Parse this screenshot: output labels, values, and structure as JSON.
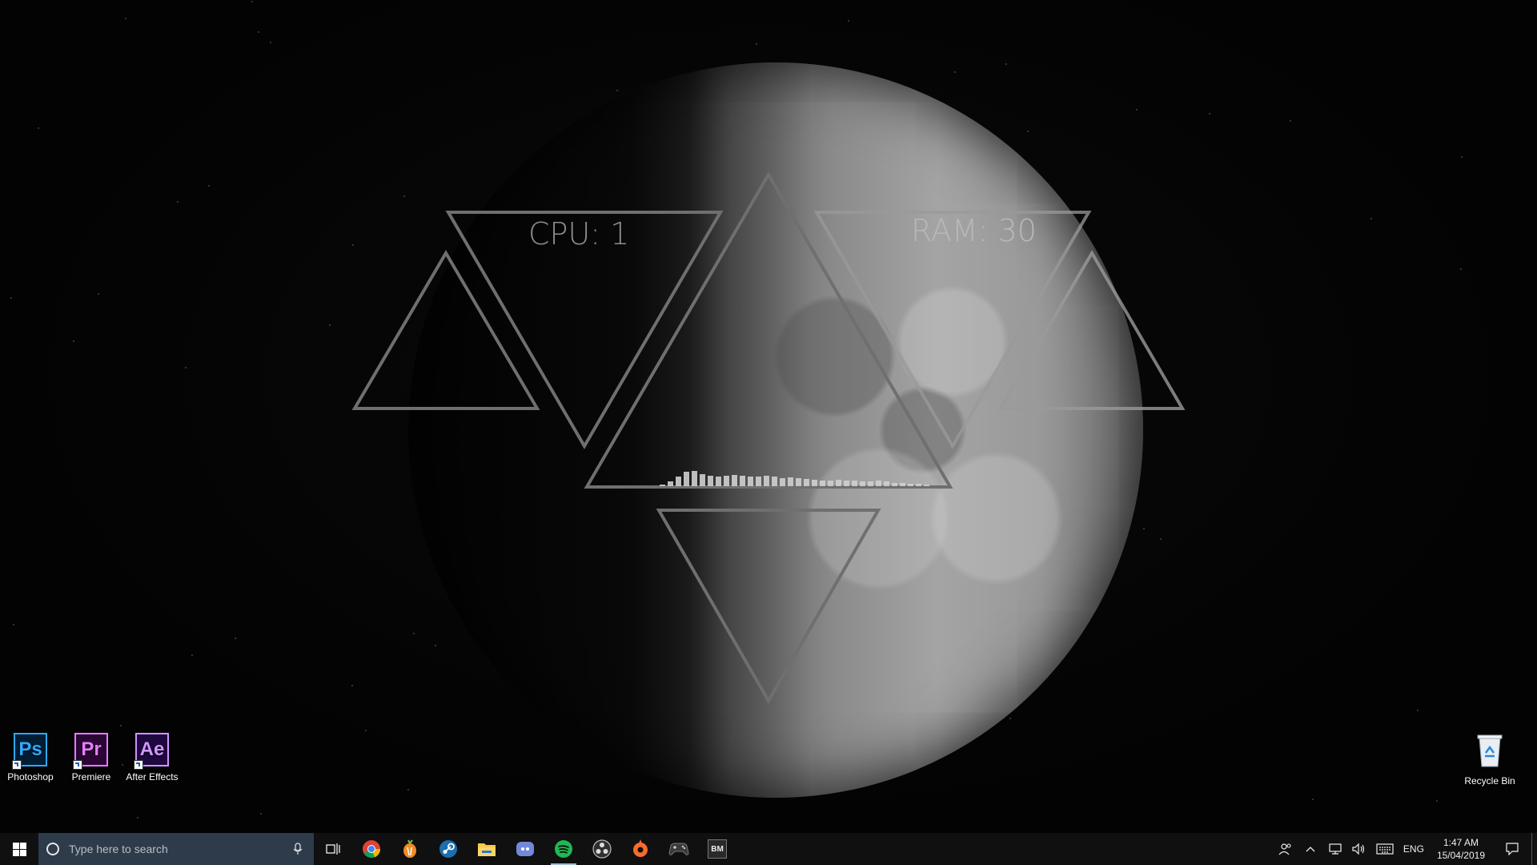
{
  "widgets": {
    "cpu_label": "CPU: 1",
    "ram_label": "RAM: 30",
    "visualizer_levels": [
      0.1,
      0.25,
      0.55,
      0.8,
      0.85,
      0.7,
      0.6,
      0.55,
      0.6,
      0.65,
      0.6,
      0.55,
      0.55,
      0.6,
      0.55,
      0.45,
      0.5,
      0.45,
      0.4,
      0.35,
      0.3,
      0.3,
      0.35,
      0.3,
      0.3,
      0.28,
      0.25,
      0.3,
      0.25,
      0.2,
      0.18,
      0.15,
      0.12,
      0.1
    ]
  },
  "desktop_icons": [
    {
      "label": "Photoshop",
      "abbr": "Ps",
      "color": "#31a8ff"
    },
    {
      "label": "Premiere",
      "abbr": "Pr",
      "color": "#e77cff"
    },
    {
      "label": "After Effects",
      "abbr": "Ae",
      "color": "#cf96fd"
    },
    {
      "label": "Recycle Bin"
    }
  ],
  "taskbar": {
    "search_placeholder": "Type here to search",
    "apps": [
      "task-view",
      "chrome",
      "fl-studio",
      "steam",
      "file-explorer",
      "discord",
      "spotify",
      "obs",
      "origin",
      "game-controller",
      "bm"
    ],
    "active_app": "spotify",
    "bm_label": "BM",
    "language": "ENG",
    "time": "1:47 AM",
    "date": "15/04/2019"
  },
  "colors": {
    "taskbar_bg": "#101010",
    "search_bg": "#2e3b4a",
    "spotify": "#1db954",
    "triangle_stroke": "#6f6f6f"
  }
}
